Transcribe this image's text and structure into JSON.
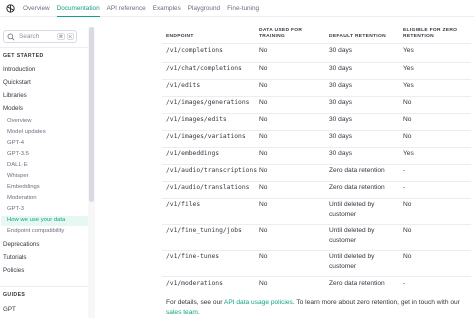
{
  "topnav": {
    "items": [
      "Overview",
      "Documentation",
      "API reference",
      "Examples",
      "Playground",
      "Fine-tuning"
    ],
    "active": "Documentation"
  },
  "sidebar": {
    "search_placeholder": "Search",
    "shortcut_mod": "⌘",
    "shortcut_key": "K",
    "section_get_started": "GET STARTED",
    "links": [
      "Introduction",
      "Quickstart",
      "Libraries",
      "Models"
    ],
    "models_sub": [
      "Overview",
      "Model updates",
      "GPT-4",
      "GPT-3.5",
      "DALL·E",
      "Whisper",
      "Embeddings",
      "Moderation",
      "GPT-3",
      "How we use your data",
      "Endpoint compatibility"
    ],
    "active_item": "How we use your data",
    "links_after": [
      "Deprecations",
      "Tutorials",
      "Policies"
    ],
    "section_guides": "GUIDES",
    "guides": [
      "GPT"
    ]
  },
  "table": {
    "headers": {
      "endpoint": "ENDPOINT",
      "training_1": "DATA USED FOR",
      "training_2": "TRAINING",
      "retention": "DEFAULT RETENTION",
      "zero_1": "ELIGIBLE FOR ZERO",
      "zero_2": "RETENTION"
    },
    "rows": [
      {
        "endpoint": "/v1/completions",
        "training": "No",
        "retention": "30 days",
        "zero": "Yes"
      },
      {
        "endpoint": "/v1/chat/completions",
        "training": "No",
        "retention": "30 days",
        "zero": "Yes"
      },
      {
        "endpoint": "/v1/edits",
        "training": "No",
        "retention": "30 days",
        "zero": "Yes"
      },
      {
        "endpoint": "/v1/images/generations",
        "training": "No",
        "retention": "30 days",
        "zero": "No"
      },
      {
        "endpoint": "/v1/images/edits",
        "training": "No",
        "retention": "30 days",
        "zero": "No"
      },
      {
        "endpoint": "/v1/images/variations",
        "training": "No",
        "retention": "30 days",
        "zero": "No"
      },
      {
        "endpoint": "/v1/embeddings",
        "training": "No",
        "retention": "30 days",
        "zero": "Yes"
      },
      {
        "endpoint": "/v1/audio/transcriptions",
        "training": "No",
        "retention": "Zero data retention",
        "zero": "-"
      },
      {
        "endpoint": "/v1/audio/translations",
        "training": "No",
        "retention": "Zero data retention",
        "zero": "-"
      },
      {
        "endpoint": "/v1/files",
        "training": "No",
        "retention_1": "Until deleted by",
        "retention_2": "customer",
        "zero": "No"
      },
      {
        "endpoint": "/v1/fine_tuning/jobs",
        "training": "No",
        "retention_1": "Until deleted by",
        "retention_2": "customer",
        "zero": "No"
      },
      {
        "endpoint": "/v1/fine-tunes",
        "training": "No",
        "retention_1": "Until deleted by",
        "retention_2": "customer",
        "zero": "No"
      },
      {
        "endpoint": "/v1/moderations",
        "training": "No",
        "retention": "Zero data retention",
        "zero": "-"
      }
    ]
  },
  "footer": {
    "prefix": "For details, see our ",
    "policy_link": "API data usage policies",
    "middle": ". To learn more about zero retention, get in touch with our ",
    "sales_link": "sales team",
    "suffix": "."
  },
  "colors": {
    "accent": "#10a37f",
    "text": "#353740",
    "muted": "#6e6e80",
    "border": "#ececf1"
  }
}
